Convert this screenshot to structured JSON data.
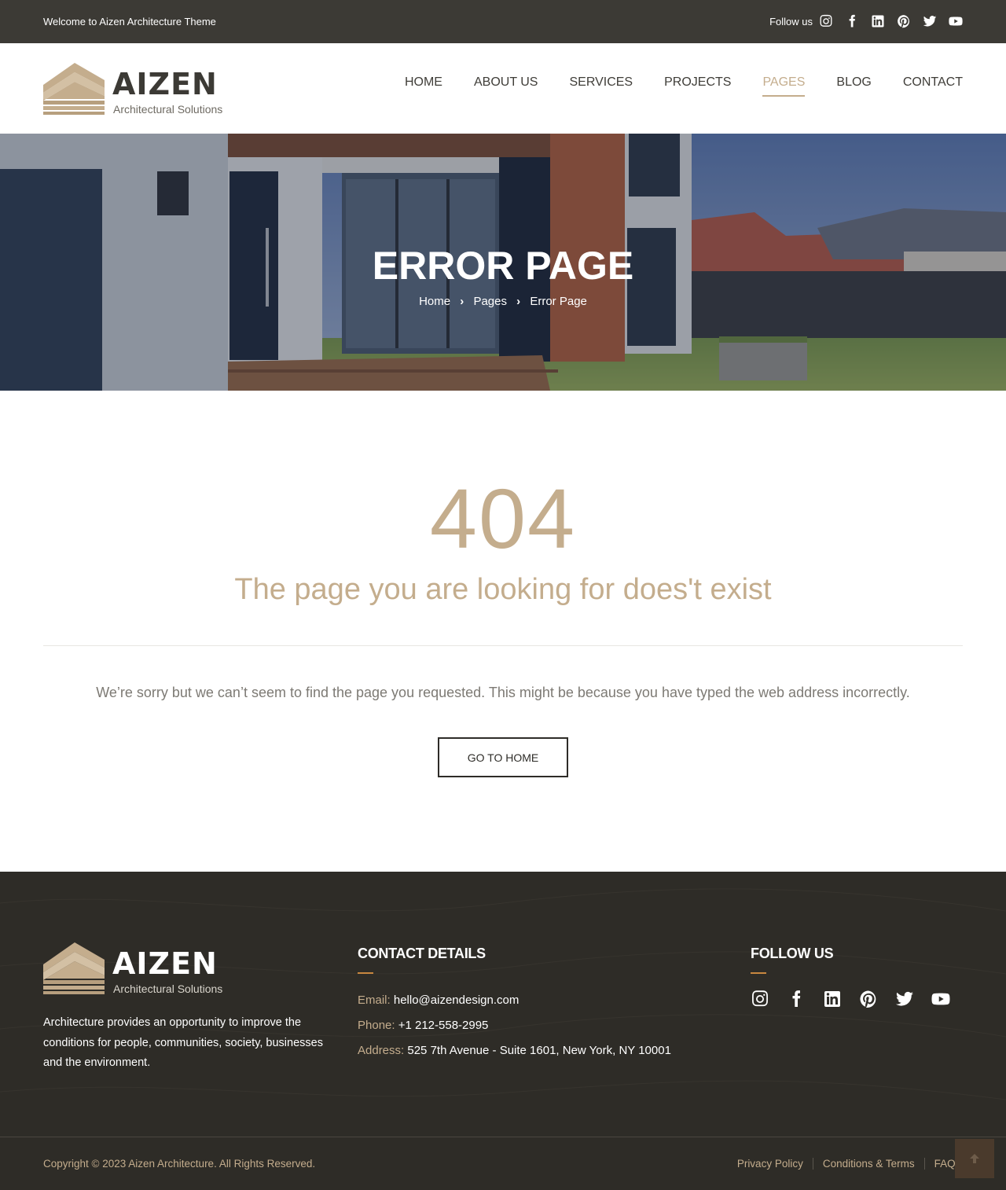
{
  "topbar": {
    "welcome": "Welcome to Aizen Architecture Theme",
    "follow_label": "Follow us",
    "socials": [
      "instagram-icon",
      "facebook-icon",
      "linkedin-icon",
      "pinterest-icon",
      "twitter-icon",
      "youtube-icon"
    ]
  },
  "header": {
    "brand": "AIZEN",
    "tagline": "Architectural Solutions",
    "nav": [
      {
        "label": "HOME",
        "active": false
      },
      {
        "label": "ABOUT US",
        "active": false
      },
      {
        "label": "SERVICES",
        "active": false
      },
      {
        "label": "PROJECTS",
        "active": false
      },
      {
        "label": "PAGES",
        "active": true
      },
      {
        "label": "BLOG",
        "active": false
      },
      {
        "label": "CONTACT",
        "active": false
      }
    ]
  },
  "hero": {
    "title": "ERROR PAGE",
    "breadcrumb": [
      "Home",
      "Pages",
      "Error Page"
    ]
  },
  "main": {
    "code": "404",
    "subtitle": "The page you are looking for does't exist",
    "message": "We’re sorry but we can’t seem to find the page you requested. This might be because you have typed the web address incorrectly.",
    "button": "GO TO HOME"
  },
  "footer": {
    "brand": "AIZEN",
    "tagline": "Architectural Solutions",
    "about": "Architecture provides an opportunity to improve the conditions for people, communities, society, businesses and the environment.",
    "contact_heading": "CONTACT DETAILS",
    "contact": [
      {
        "label": "Email:",
        "value": "hello@aizendesign.com"
      },
      {
        "label": "Phone:",
        "value": "+1 212-558-2995"
      },
      {
        "label": "Address:",
        "value": "525 7th Avenue - Suite 1601, New York, NY 10001"
      }
    ],
    "follow_heading": "FOLLOW US",
    "copyright": "Copyright © 2023 Aizen Architecture. All Rights Reserved.",
    "links": [
      "Privacy Policy",
      "Conditions & Terms",
      "FAQ's"
    ]
  },
  "colors": {
    "accent": "#c4ad8d",
    "dark": "#3c3a35",
    "footer_bg": "#2e2c27",
    "heading_underline": "#c8873f"
  }
}
